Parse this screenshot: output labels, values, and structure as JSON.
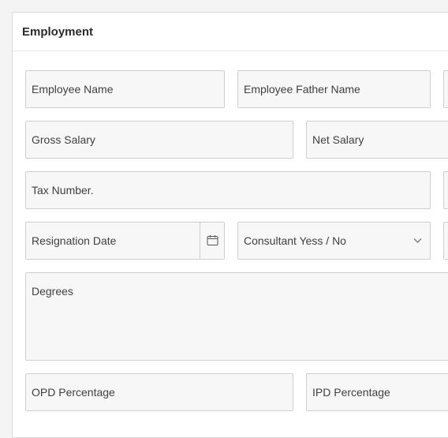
{
  "section": {
    "title": "Employment"
  },
  "fields": {
    "employee_name": "Employee Name",
    "employee_father_name": "Employee Father Name",
    "gross_salary": "Gross Salary",
    "net_salary": "Net Salary",
    "tax_number": "Tax Number.",
    "resignation_date": "Resignation Date",
    "consultant": "Consultant Yess / No",
    "degrees": "Degrees",
    "opd_percentage": "OPD Percentage",
    "ipd_percentage": "IPD Percentage"
  },
  "icons": {
    "calendar": "calendar-icon",
    "dropdown": "chevron-down-icon"
  }
}
